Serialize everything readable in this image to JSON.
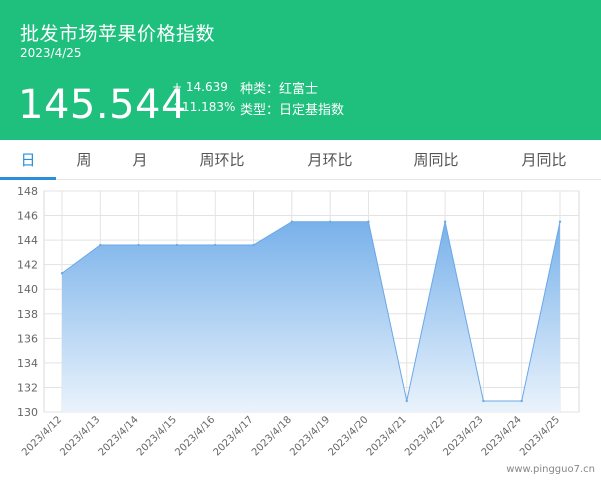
{
  "header": {
    "title": "批发市场苹果价格指数",
    "date": "2023/4/25",
    "price": "145.544",
    "change_abs": "+ 14.639",
    "change_pct": "↑11.183%",
    "meta_variety": "种类：红富士",
    "meta_type": "类型：日定基指数"
  },
  "tabs": [
    "日",
    "周",
    "月",
    "周环比",
    "月环比",
    "周同比",
    "月同比"
  ],
  "active_tab": 0,
  "colors": {
    "header_bg": "#1fbf7e",
    "accent": "#2a8fd6",
    "area_top": "#78b1ea",
    "area_bottom": "#eaf3fc",
    "line": "#6aa8e6"
  },
  "watermark": "www.pingguo7.cn",
  "chart_data": {
    "type": "area",
    "x": [
      "2023/4/12",
      "2023/4/13",
      "2023/4/14",
      "2023/4/15",
      "2023/4/16",
      "2023/4/17",
      "2023/4/18",
      "2023/4/19",
      "2023/4/20",
      "2023/4/21",
      "2023/4/22",
      "2023/4/23",
      "2023/4/24",
      "2023/4/25"
    ],
    "values": [
      141.3,
      143.6,
      143.6,
      143.6,
      143.6,
      143.6,
      145.5,
      145.5,
      145.5,
      130.9,
      145.5,
      130.9,
      130.9,
      145.5
    ],
    "ylim": [
      130,
      148
    ],
    "yticks": [
      130,
      132,
      134,
      136,
      138,
      140,
      142,
      144,
      146,
      148
    ],
    "grid": true
  }
}
